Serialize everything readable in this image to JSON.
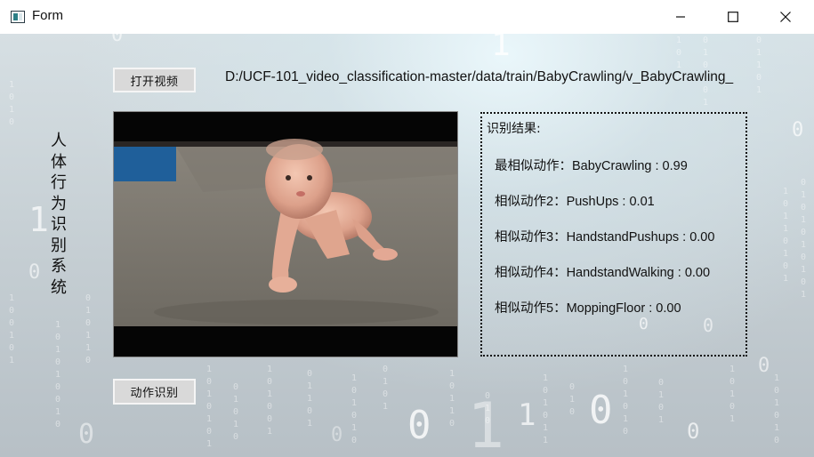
{
  "window": {
    "title": "Form",
    "icon": "app-window-icon",
    "controls": [
      "minimize-icon",
      "maximize-icon",
      "close-icon"
    ]
  },
  "toolbar": {
    "open_video_label": "打开视频",
    "file_path": "D:/UCF-101_video_classification-master/data/train/BabyCrawling/v_BabyCrawling_"
  },
  "side_title": "人体行为识别系统",
  "video": {
    "description_icon": "video-frame"
  },
  "result": {
    "header": "识别结果:",
    "lines": [
      "最相似动作：BabyCrawling : 0.99",
      "相似动作2：PushUps : 0.01",
      "相似动作3：HandstandPushups : 0.00",
      "相似动作4：HandstandWalking : 0.00",
      "相似动作5：MoppingFloor : 0.00"
    ]
  },
  "actions": {
    "recognize_label": "动作识别"
  }
}
